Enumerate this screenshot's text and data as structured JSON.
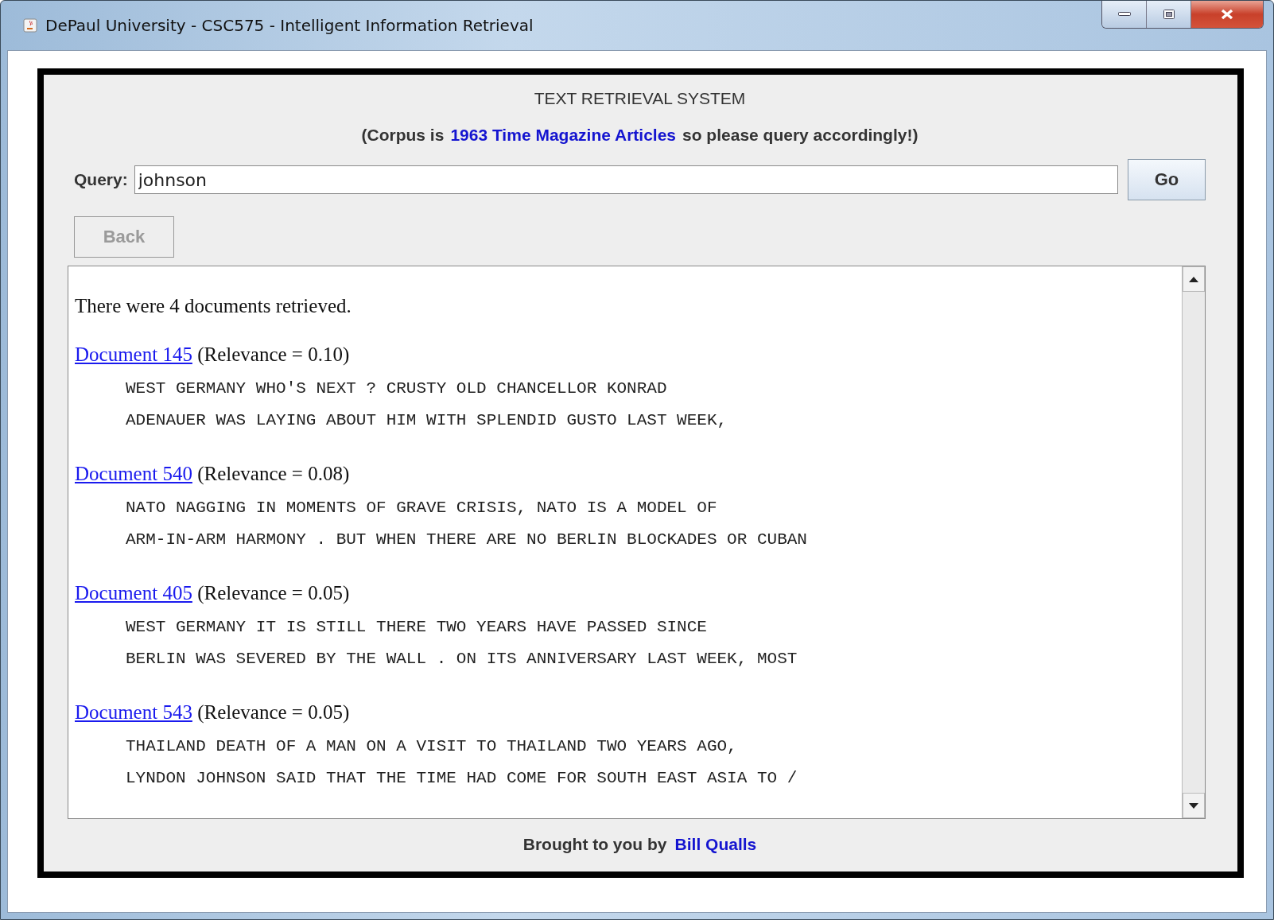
{
  "window": {
    "title": "DePaul University - CSC575 - Intelligent Information Retrieval"
  },
  "header": {
    "title": "TEXT RETRIEVAL SYSTEM",
    "subtitle_prefix": "(Corpus is",
    "subtitle_link": "1963 Time Magazine Articles",
    "subtitle_suffix": "so please query accordingly!)"
  },
  "query": {
    "label": "Query:",
    "value": "johnson"
  },
  "go_button": {
    "label": "Go"
  },
  "back_button": {
    "label": "Back",
    "disabled": true
  },
  "results": {
    "summary": "There were 4 documents retrieved.",
    "documents": [
      {
        "link": "Document 145",
        "relevance": "(Relevance = 0.10)",
        "lines": [
          "WEST GERMANY WHO'S NEXT ? CRUSTY OLD CHANCELLOR KONRAD",
          "ADENAUER WAS LAYING ABOUT HIM WITH SPLENDID GUSTO LAST WEEK,"
        ]
      },
      {
        "link": "Document 540",
        "relevance": "(Relevance = 0.08)",
        "lines": [
          "NATO NAGGING IN MOMENTS OF GRAVE CRISIS, NATO IS A MODEL OF",
          "ARM-IN-ARM HARMONY . BUT WHEN THERE ARE NO BERLIN BLOCKADES OR CUBAN"
        ]
      },
      {
        "link": "Document 405",
        "relevance": "(Relevance = 0.05)",
        "lines": [
          "WEST GERMANY IT IS STILL THERE TWO YEARS HAVE PASSED SINCE",
          "BERLIN WAS SEVERED BY THE WALL . ON ITS ANNIVERSARY LAST WEEK, MOST"
        ]
      },
      {
        "link": "Document 543",
        "relevance": "(Relevance = 0.05)",
        "lines": [
          "THAILAND DEATH OF A MAN ON A VISIT TO THAILAND TWO YEARS AGO,",
          "LYNDON JOHNSON SAID THAT THE TIME HAD COME FOR SOUTH EAST ASIA TO /"
        ]
      }
    ]
  },
  "footer": {
    "prefix": "Brought to you by",
    "author": "Bill Qualls"
  }
}
